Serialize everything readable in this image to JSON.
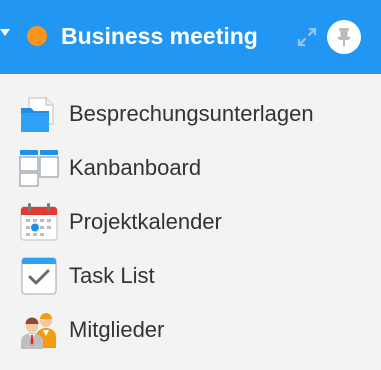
{
  "header": {
    "title": "Business meeting",
    "status_color": "#f7941d",
    "background": "#2196f3",
    "icons": [
      "collapse-caret-icon",
      "expand-icon",
      "pin-icon"
    ]
  },
  "menu": {
    "items": [
      {
        "label": "Besprechungsunterlagen",
        "icon": "folder-icon"
      },
      {
        "label": "Kanbanboard",
        "icon": "kanban-icon"
      },
      {
        "label": "Projektkalender",
        "icon": "calendar-icon"
      },
      {
        "label": "Task List",
        "icon": "checklist-icon"
      },
      {
        "label": "Mitglieder",
        "icon": "members-icon"
      }
    ]
  }
}
